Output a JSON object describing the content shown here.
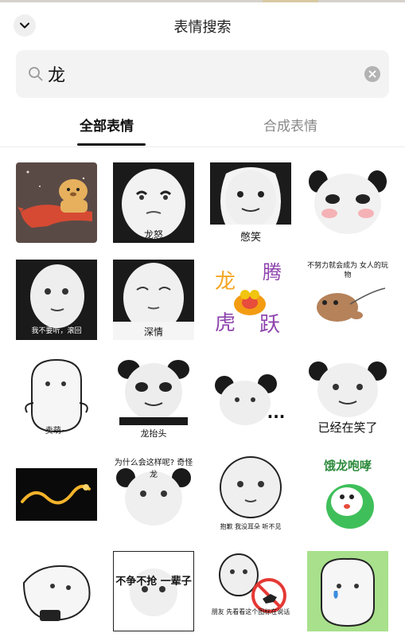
{
  "header": {
    "title": "表情搜索"
  },
  "search": {
    "query": "龙",
    "placeholder": ""
  },
  "tabs": [
    {
      "label": "全部表情",
      "active": true
    },
    {
      "label": "合成表情",
      "active": false
    }
  ],
  "colors": {
    "accent": "#111111",
    "muted_tab": "#888888",
    "search_bg": "#f3f3f3"
  },
  "stickers": [
    {
      "caption": "",
      "icon": "capybara-riding-dragon"
    },
    {
      "caption": "龙怒",
      "icon": "panda-face"
    },
    {
      "caption": "憋笑",
      "icon": "panda-face"
    },
    {
      "caption": "",
      "icon": "panda-blush-face"
    },
    {
      "caption": "我不要听，滚回",
      "icon": "panda-face"
    },
    {
      "caption": "深情",
      "icon": "panda-face"
    },
    {
      "caption": "龙腾虎跃",
      "icon": "tiger-dragon-art"
    },
    {
      "caption": "不努力就会成为 女人的玩物",
      "icon": "leashed-creature"
    },
    {
      "caption": "卖萌~",
      "icon": "panda-face"
    },
    {
      "caption": "龙抬头",
      "icon": "panda-face"
    },
    {
      "caption": "...",
      "icon": "panda-face"
    },
    {
      "caption": "已经在笑了",
      "icon": "panda-face"
    },
    {
      "caption": "",
      "icon": "golden-dragon"
    },
    {
      "caption": "为什么会这样呢? 奇怪龙",
      "icon": "panda-face"
    },
    {
      "caption": "抱歉 我没耳朵 听不见",
      "icon": "panda-face"
    },
    {
      "caption": "饿龙咆哮",
      "icon": "green-dragon-cartoon"
    },
    {
      "caption": "",
      "icon": "panda-lying-face"
    },
    {
      "caption": "不争不抢 一辈子",
      "icon": "panda-face"
    },
    {
      "caption": "朋友 先看看这个图标在说话",
      "icon": "no-dogs-sign"
    },
    {
      "caption": "",
      "icon": "panda-crying-face"
    }
  ]
}
